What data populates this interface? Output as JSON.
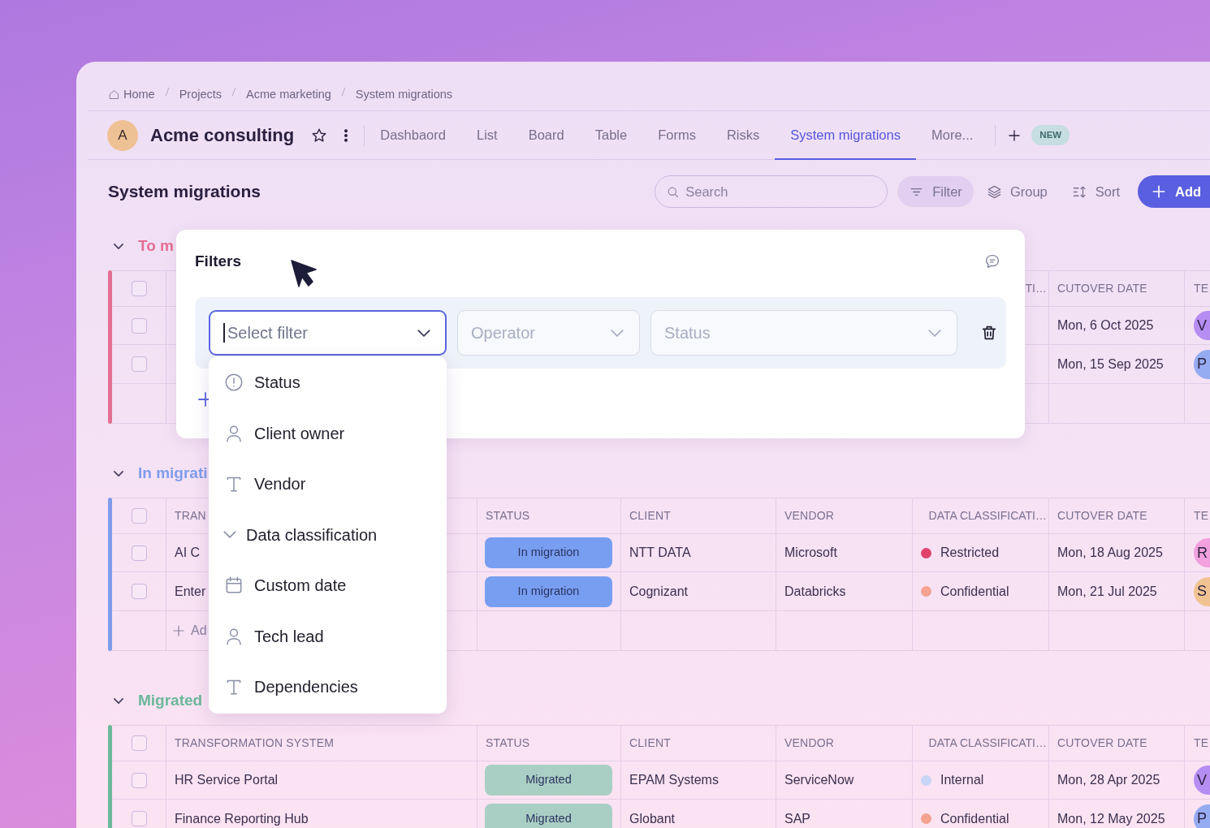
{
  "breadcrumb": [
    {
      "label": "Home",
      "kind": "home"
    },
    {
      "label": "Projects",
      "kind": "link"
    },
    {
      "label": "Acme marketing",
      "kind": "link"
    },
    {
      "label": "System migrations",
      "kind": "link"
    }
  ],
  "project": {
    "initial": "A",
    "name": "Acme consulting"
  },
  "tabs": [
    {
      "label": "Dashbaord",
      "selected": false
    },
    {
      "label": "List",
      "selected": false
    },
    {
      "label": "Board",
      "selected": false
    },
    {
      "label": "Table",
      "selected": false
    },
    {
      "label": "Forms",
      "selected": false
    },
    {
      "label": "Risks",
      "selected": false
    },
    {
      "label": "System migrations",
      "selected": true
    },
    {
      "label": "More...",
      "selected": false
    }
  ],
  "new_badge": "NEW",
  "page_title": "System migrations",
  "search": {
    "placeholder": "Search"
  },
  "toolbar_buttons": [
    {
      "label": "Filter",
      "kind": "filter"
    },
    {
      "label": "Group",
      "kind": "group"
    },
    {
      "label": "Sort",
      "kind": "sort"
    },
    {
      "label": "Add",
      "kind": "add"
    }
  ],
  "groups": [
    {
      "title": "To m",
      "color": "#e46f94",
      "expanded": true,
      "all_checked": false,
      "headers": {
        "classification": "TI…",
        "cutover": "CUTOVER DATE",
        "lead": "TE"
      },
      "rows": [
        {
          "checked": false,
          "cutover": "Mon, 6 Oct 2025",
          "lead": {
            "initial": "V",
            "color": "#b68df2"
          }
        },
        {
          "checked": false,
          "cutover": "Mon, 15 Sep 2025",
          "lead": {
            "initial": "P",
            "color": "#95abf2"
          }
        }
      ]
    },
    {
      "title": "In migrati",
      "color": "#7f9cec",
      "expanded": true,
      "all_checked": false,
      "add_label": "Ad",
      "headers": {
        "system": "TRAN",
        "status": "STATUS",
        "client": "CLIENT",
        "vendor": "VENDOR",
        "classification": "DATA CLASSIFICATI…",
        "cutover": "CUTOVER DATE",
        "lead": "TE"
      },
      "rows": [
        {
          "checked": false,
          "system": "AI C",
          "status": {
            "label": "In migration",
            "color": "#789ef2"
          },
          "client": "NTT DATA",
          "vendor": "Microsoft",
          "classification": {
            "label": "Restricted",
            "color": "#e0426b"
          },
          "cutover": "Mon, 18 Aug 2025",
          "lead": {
            "initial": "R",
            "color": "#f2a0de"
          }
        },
        {
          "checked": false,
          "system": "Enter",
          "status": {
            "label": "In migration",
            "color": "#789ef2"
          },
          "client": "Cognizant",
          "vendor": "Databricks",
          "classification": {
            "label": "Confidential",
            "color": "#f5a290"
          },
          "cutover": "Mon, 21 Jul 2025",
          "lead": {
            "initial": "S",
            "color": "#f2c392"
          }
        }
      ]
    },
    {
      "title": "Migrated",
      "color": "#6cb89a",
      "expanded": true,
      "all_checked": false,
      "headers": {
        "system": "TRANSFORMATION SYSTEM",
        "status": "STATUS",
        "client": "CLIENT",
        "vendor": "VENDOR",
        "classification": "DATA CLASSIFICATI…",
        "cutover": "CUTOVER DATE",
        "lead": "TE"
      },
      "rows": [
        {
          "checked": false,
          "system": "HR Service Portal",
          "status": {
            "label": "Migrated",
            "color": "#a9cfc4"
          },
          "client": "EPAM Systems",
          "vendor": "ServiceNow",
          "classification": {
            "label": "Internal",
            "color": "#c9d5f6"
          },
          "cutover": "Mon, 28 Apr 2025",
          "lead": {
            "initial": "V",
            "color": "#b68df2"
          }
        },
        {
          "checked": false,
          "system": "Finance Reporting Hub",
          "status": {
            "label": "Migrated",
            "color": "#a9cfc4"
          },
          "client": "Globant",
          "vendor": "SAP",
          "classification": {
            "label": "Confidential",
            "color": "#f5a290"
          },
          "cutover": "Mon, 12 May 2025",
          "lead": {
            "initial": "P",
            "color": "#95abf2"
          }
        }
      ]
    }
  ],
  "filter_panel": {
    "title": "Filters",
    "fields": [
      {
        "placeholder": "Select filter",
        "focused": true
      },
      {
        "placeholder": "Operator",
        "focused": false
      },
      {
        "placeholder": "Status",
        "focused": false
      }
    ],
    "menu": [
      {
        "label": "Status",
        "kind": "status"
      },
      {
        "label": "Client owner",
        "kind": "person"
      },
      {
        "label": "Vendor",
        "kind": "text"
      },
      {
        "label": "Data classification",
        "kind": "choice"
      },
      {
        "label": "Custom date",
        "kind": "date"
      },
      {
        "label": "Tech lead",
        "kind": "person"
      },
      {
        "label": "Dependencies",
        "kind": "text"
      }
    ]
  }
}
